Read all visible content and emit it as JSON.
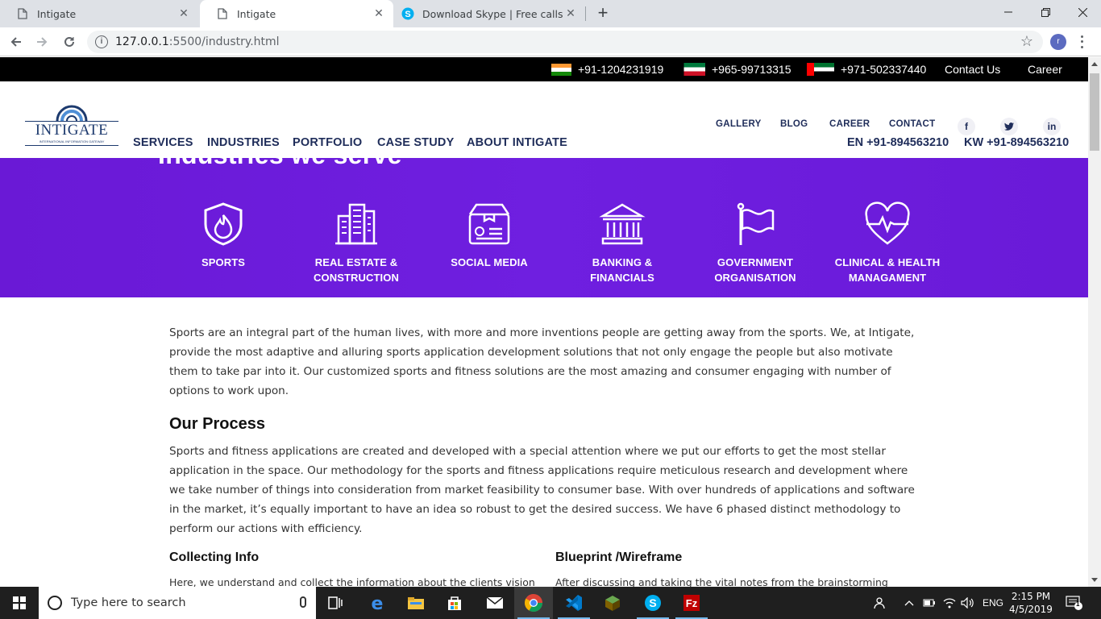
{
  "browser": {
    "tabs": [
      {
        "title": "Intigate",
        "icon": "document-icon",
        "active": false
      },
      {
        "title": "Intigate",
        "icon": "document-icon",
        "active": true
      },
      {
        "title": "Download Skype | Free calls | Cha",
        "icon": "skype-icon",
        "active": false
      }
    ],
    "url_host": "127.0.0.1",
    "url_path": ":5500/industry.html",
    "profile_initial": "r"
  },
  "topbar": {
    "phones": [
      {
        "flag": "india",
        "number": "+91-1204231919"
      },
      {
        "flag": "kuwait",
        "number": "+965-99713315"
      },
      {
        "flag": "uae",
        "number": "+971-502337440"
      }
    ],
    "contact": "Contact Us",
    "career": "Career"
  },
  "header": {
    "logo_text": "INTIGATE",
    "logo_tagline": "INTERNATIONAL INFORMATION GATEWAY",
    "main_nav": [
      "SERVICES",
      "INDUSTRIES",
      "PORTFOLIO",
      "CASE STUDY",
      "ABOUT INTIGATE"
    ],
    "sub_nav": [
      "GALLERY",
      "BLOG",
      "CAREER",
      "CONTACT"
    ],
    "social": [
      "f",
      "t",
      "in"
    ],
    "phone_en": "EN +91-894563210",
    "phone_kw": "KW +91-894563210"
  },
  "hero": {
    "title": "Industries we serve",
    "industries": [
      {
        "line1": "SPORTS",
        "line2": "",
        "icon": "sports-shield-icon",
        "active": true
      },
      {
        "line1": "REAL ESTATE &",
        "line2": "CONSTRUCTION",
        "icon": "building-icon",
        "active": false
      },
      {
        "line1": "SOCIAL MEDIA",
        "line2": "",
        "icon": "social-box-icon",
        "active": false
      },
      {
        "line1": "BANKING & FINANCIALS",
        "line2": "",
        "icon": "bank-icon",
        "active": false
      },
      {
        "line1": "GOVERNMENT",
        "line2": "ORGANISATION",
        "icon": "flag-icon",
        "active": false
      },
      {
        "line1": "CLINICAL & HEALTH",
        "line2": "MANAGAMENT",
        "icon": "heart-pulse-icon",
        "active": false
      }
    ]
  },
  "content": {
    "intro": "Sports are an integral part of the human lives, with more and more inventions people are getting away from the sports. We, at Intigate, provide the most adaptive and alluring sports application development solutions that not only engage the people but also motivate them to take par into it. Our customized sports and fitness solutions are the most amazing and consumer engaging with number of options to work upon.",
    "process_heading": "Our Process",
    "process_text": "Sports and fitness applications are created and developed with a special attention where we put our efforts to get the most stellar application in the space. Our methodology for the sports and fitness applications require meticulous research and development where we take number of things into consideration from market feasibility to consumer base. With over hundreds of applications and software in the market, it’s equally important to have an idea so robust to get the desired success. We have 6 phased distinct methodology to perform our actions with efficiency.",
    "col1_heading": "Collecting Info",
    "col1_text": "Here, we understand and collect the information about the clients vision and",
    "col2_heading": "Blueprint /Wireframe",
    "col2_text": "After discussing and taking the vital notes from the brainstorming sessions,"
  },
  "taskbar": {
    "search_placeholder": "Type here to search",
    "lang": "ENG",
    "time": "2:15 PM",
    "date": "4/5/2019",
    "notifications": "1"
  }
}
